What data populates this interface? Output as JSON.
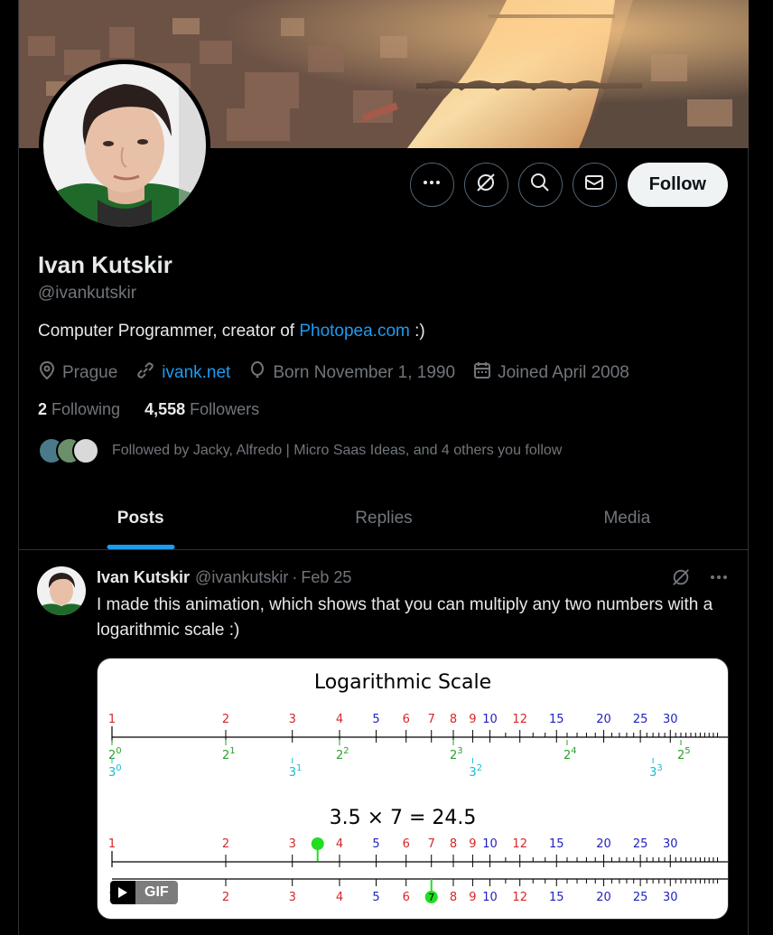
{
  "profile": {
    "name": "Ivan Kutskir",
    "handle": "@ivankutskir",
    "bio_prefix": "Computer Programmer, creator of ",
    "bio_link": "Photopea.com",
    "bio_suffix": " :)",
    "location": "Prague",
    "website": "ivank.net",
    "birthday": "Born November 1, 1990",
    "joined": "Joined April 2008",
    "following_count": "2",
    "following_label": "Following",
    "followers_count": "4,558",
    "followers_label": "Followers",
    "followed_by": "Followed by Jacky, Alfredo | Micro Saas Ideas, and 4 others you follow"
  },
  "actions": {
    "follow_label": "Follow",
    "icons": [
      "more-icon",
      "grok-icon",
      "search-icon",
      "message-icon"
    ]
  },
  "tabs": [
    {
      "label": "Posts",
      "active": true
    },
    {
      "label": "Replies",
      "active": false
    },
    {
      "label": "Media",
      "active": false
    }
  ],
  "post": {
    "name": "Ivan Kutskir",
    "handle": "@ivankutskir",
    "separator": "·",
    "date": "Feb 25",
    "text": "I made this animation, which shows that you can multiply any two numbers with a logarithmic scale :)",
    "gif_label": "GIF"
  },
  "media_chart": {
    "title": "Logarithmic Scale",
    "equation": "3.5 × 7 = 24.5",
    "ticks": [
      {
        "label": "1",
        "value": 1,
        "color": "#d62728"
      },
      {
        "label": "2",
        "value": 2,
        "color": "#d62728"
      },
      {
        "label": "3",
        "value": 3,
        "color": "#d62728"
      },
      {
        "label": "4",
        "value": 4,
        "color": "#d62728"
      },
      {
        "label": "5",
        "value": 5,
        "color": "#1f1fbf"
      },
      {
        "label": "6",
        "value": 6,
        "color": "#d62728"
      },
      {
        "label": "7",
        "value": 7,
        "color": "#d62728"
      },
      {
        "label": "8",
        "value": 8,
        "color": "#d62728"
      },
      {
        "label": "9",
        "value": 9,
        "color": "#d62728"
      },
      {
        "label": "10",
        "value": 10,
        "color": "#1f1fbf"
      },
      {
        "label": "12",
        "value": 12,
        "color": "#d62728"
      },
      {
        "label": "15",
        "value": 15,
        "color": "#1f1fbf"
      },
      {
        "label": "20",
        "value": 20,
        "color": "#1f1fbf"
      },
      {
        "label": "25",
        "value": 25,
        "color": "#1f1fbf"
      },
      {
        "label": "30",
        "value": 30,
        "color": "#1f1fbf"
      }
    ],
    "powers_of_two": [
      {
        "base": "2",
        "exp": "0",
        "value": 1
      },
      {
        "base": "2",
        "exp": "1",
        "value": 2
      },
      {
        "base": "2",
        "exp": "2",
        "value": 4
      },
      {
        "base": "2",
        "exp": "3",
        "value": 8
      },
      {
        "base": "2",
        "exp": "4",
        "value": 16
      },
      {
        "base": "2",
        "exp": "5",
        "value": 32
      }
    ],
    "powers_of_three": [
      {
        "base": "3",
        "exp": "0",
        "value": 1
      },
      {
        "base": "3",
        "exp": "1",
        "value": 3
      },
      {
        "base": "3",
        "exp": "2",
        "value": 9
      },
      {
        "base": "3",
        "exp": "3",
        "value": 27
      }
    ],
    "marker_a": {
      "value": 3.5,
      "color": "#22dd22"
    },
    "marker_b": {
      "value": 7,
      "label": "7",
      "color": "#22dd22"
    },
    "colors": {
      "red": "#d62728",
      "blue": "#1f1fbf",
      "green": "#2ca02c",
      "cyan": "#17becf"
    }
  },
  "colors": {
    "accent": "#1d9bf0",
    "text": "#e7e9ea",
    "muted": "#71767b",
    "border": "#2f3336"
  }
}
